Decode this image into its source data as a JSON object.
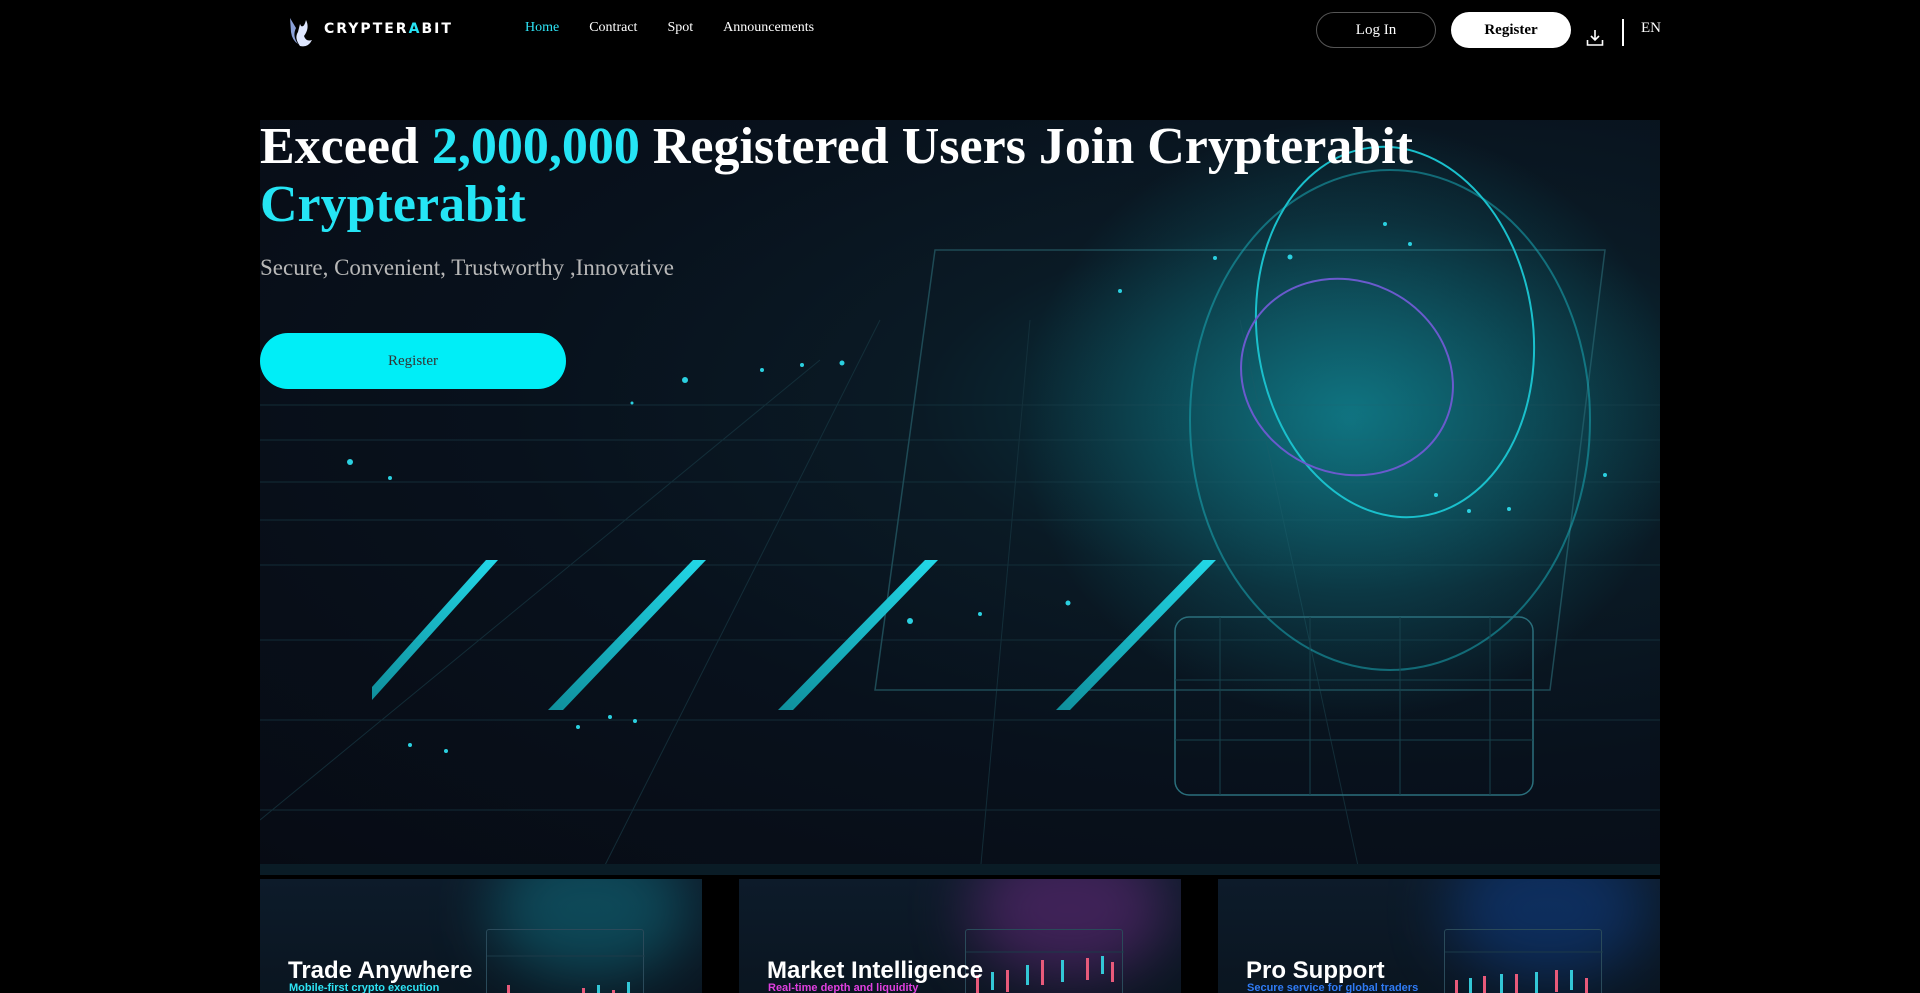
{
  "header": {
    "logo_text_a": "CRYPTER",
    "logo_text_b": "A",
    "logo_text_c": "BIT",
    "nav": [
      {
        "label": "Home",
        "active": true
      },
      {
        "label": "Contract",
        "active": false
      },
      {
        "label": "Spot",
        "active": false
      },
      {
        "label": "Announcements",
        "active": false
      }
    ],
    "login_label": "Log In",
    "register_label": "Register",
    "download_icon": "download-icon",
    "language": "EN"
  },
  "hero": {
    "title_prefix": "Exceed",
    "title_number": "2,000,000",
    "title_suffix": "Registered Users Join Crypterabit",
    "title_second_line": "Crypterabit",
    "subtitle": "Secure, Convenient, Trustworthy ,Innovative",
    "cta_label": "Register"
  },
  "cards": [
    {
      "title": "Trade Anywhere",
      "subtitle": "Mobile-first crypto execution",
      "subtitle_color": "#2ee4f5"
    },
    {
      "title": "Market Intelligence",
      "subtitle": "Real-time depth and liquidity",
      "subtitle_color": "#e040e0"
    },
    {
      "title": "Pro Support",
      "subtitle": "Secure service for global traders",
      "subtitle_color": "#2f7bf5"
    }
  ],
  "colors": {
    "accent": "#25e5f5",
    "background": "#000000",
    "cta": "#00eef7"
  }
}
